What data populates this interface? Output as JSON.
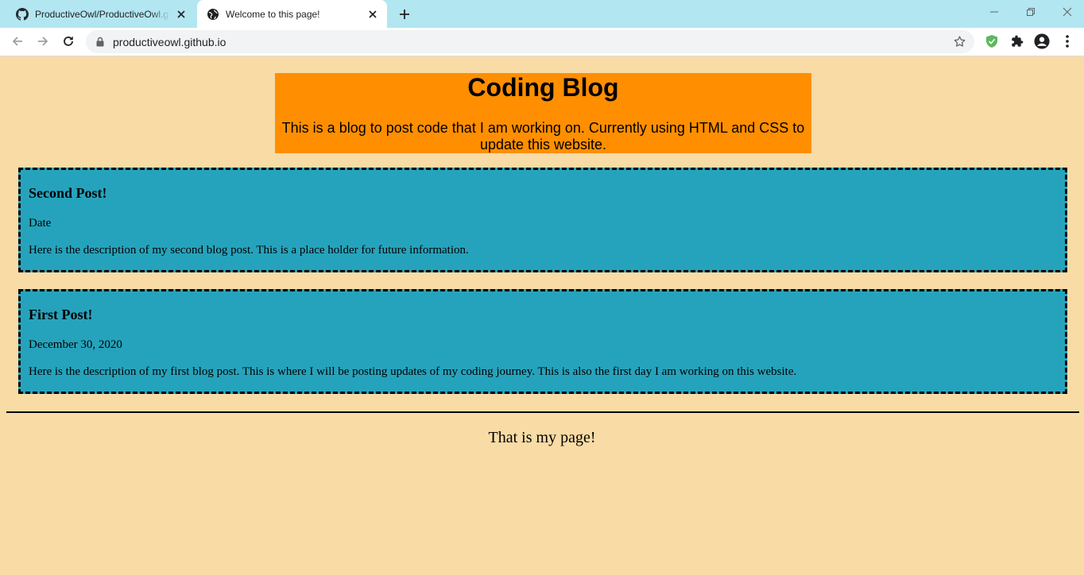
{
  "browser": {
    "tabs": [
      {
        "title": "ProductiveOwl/ProductiveOwl.github.io",
        "icon": "github-icon",
        "active": false
      },
      {
        "title": "Welcome to this page!",
        "icon": "globe-icon",
        "active": true
      }
    ],
    "url": "productiveowl.github.io"
  },
  "page": {
    "header": {
      "title": "Coding Blog",
      "subtitle": "This is a blog to post code that I am working on. Currently using HTML and CSS to update this website."
    },
    "posts": [
      {
        "title": "Second Post!",
        "date": "Date",
        "description": "Here is the description of my second blog post. This is a place holder for future information."
      },
      {
        "title": "First Post!",
        "date": "December 30, 2020",
        "description": "Here is the description of my first blog post. This is where I will be posting updates of my coding journey. This is also the first day I am working on this website."
      }
    ],
    "footer": "That is my page!"
  },
  "colors": {
    "page_background": "#f9dba6",
    "header_background": "#ff8f00",
    "post_background": "#26a3bc",
    "tabbar_background": "#b2e6f1"
  }
}
